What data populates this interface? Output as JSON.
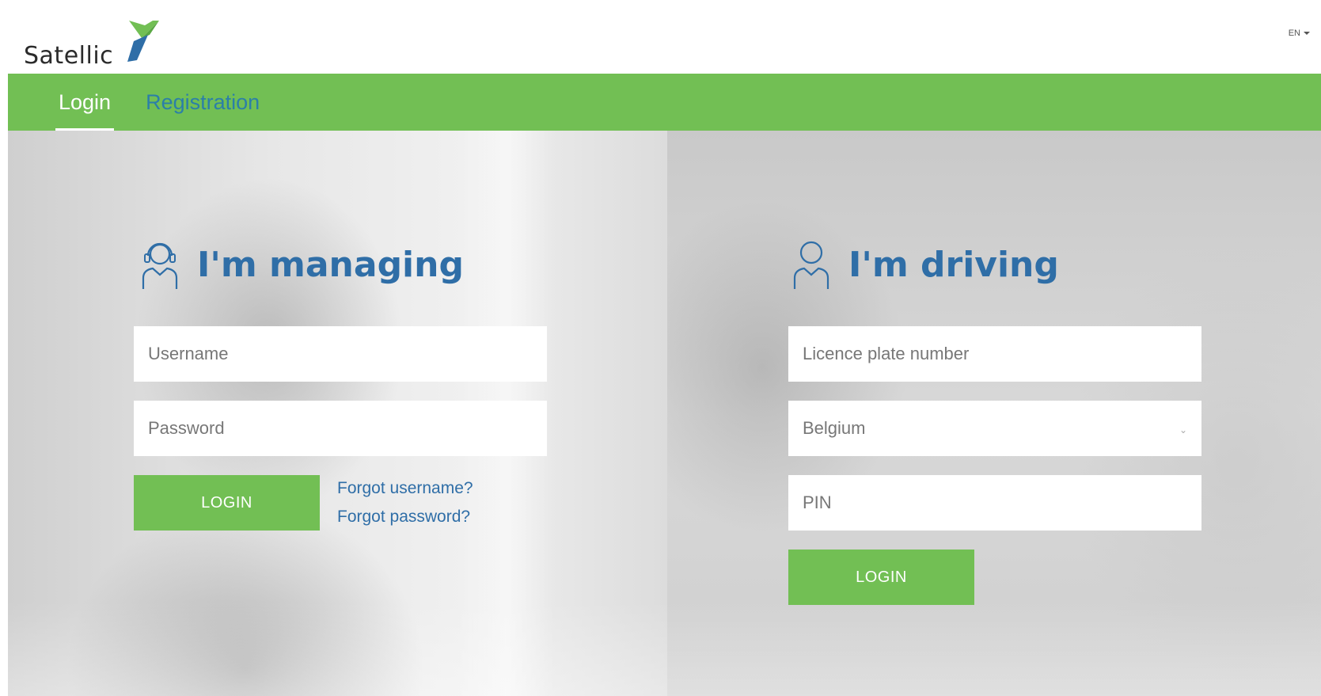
{
  "header": {
    "brand": "Satellic",
    "language": "EN",
    "colors": {
      "brand_green": "#72bf54",
      "brand_blue": "#2f6ea7"
    }
  },
  "nav": {
    "tabs": [
      {
        "label": "Login",
        "active": true
      },
      {
        "label": "Registration",
        "active": false
      }
    ]
  },
  "managing": {
    "title": "I'm managing",
    "icon": "headset-user-icon",
    "username_placeholder": "Username",
    "password_placeholder": "Password",
    "login_label": "LOGIN",
    "forgot_username": "Forgot username?",
    "forgot_password": "Forgot password?"
  },
  "driving": {
    "title": "I'm driving",
    "icon": "user-icon",
    "plate_placeholder": "Licence plate number",
    "country_selected": "Belgium",
    "pin_placeholder": "PIN",
    "login_label": "LOGIN"
  }
}
